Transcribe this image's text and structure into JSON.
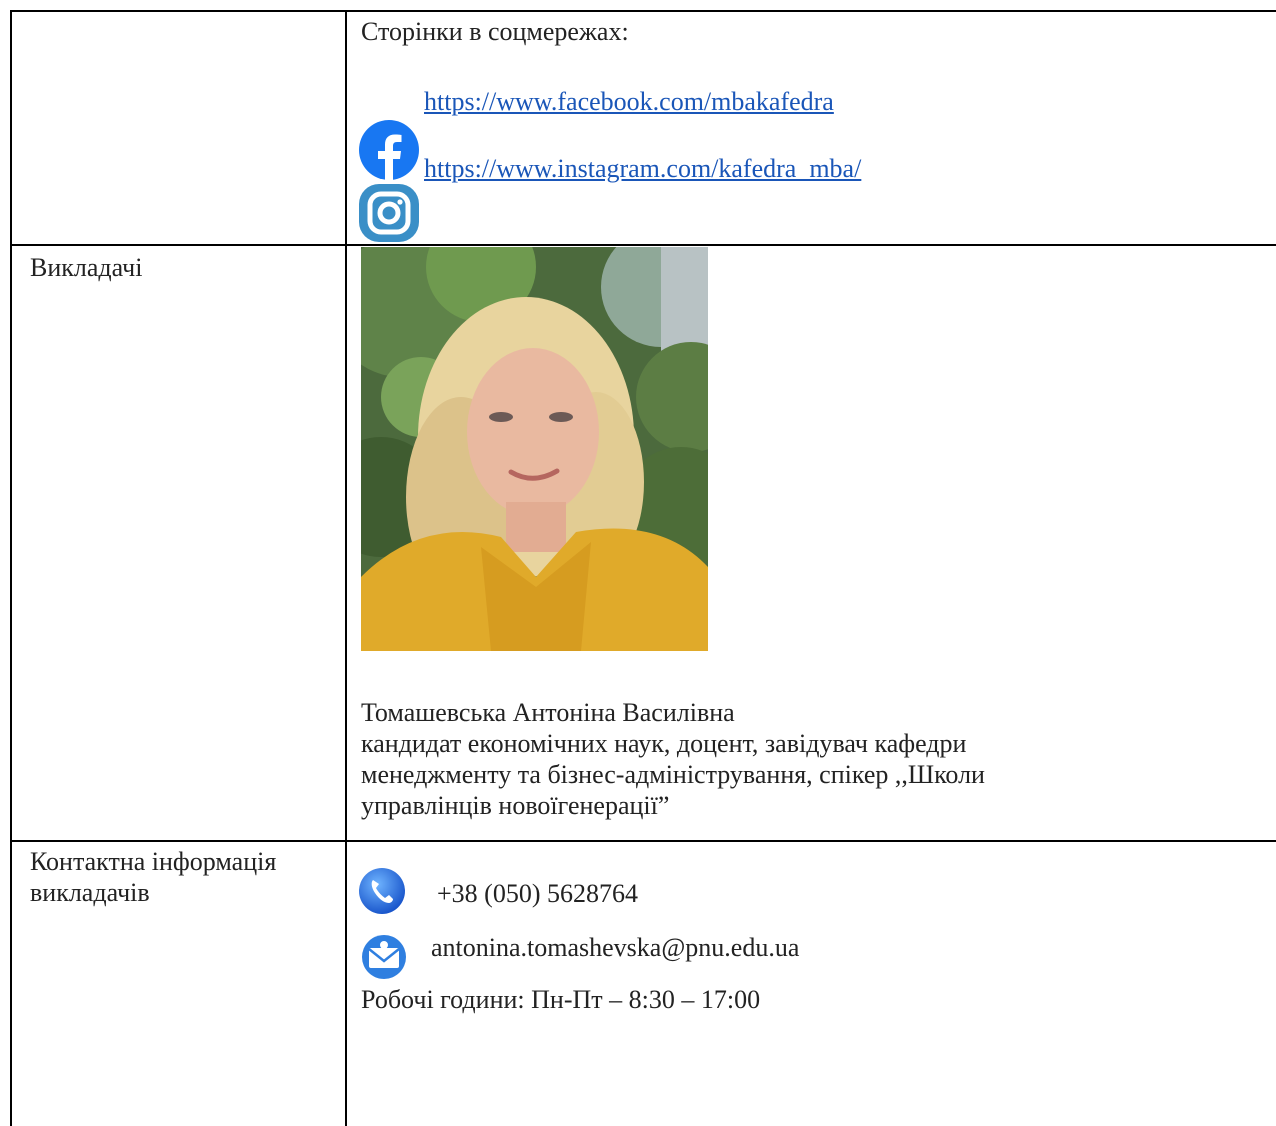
{
  "social": {
    "heading": "Сторінки в соцмережах:",
    "facebook_url": "https://www.facebook.com/mbakafedra",
    "instagram_url": "https://www.instagram.com/kafedra_mba/"
  },
  "teachers": {
    "label": "Викладачі",
    "name": "Томашевська Антоніна Василівна",
    "description_lines": [
      "кандидат економічних наук, доцент, завідувач кафедри",
      "менеджменту та бізнес-адміністрування, спікер ,,Школи",
      "управлінців новоїгенерації”"
    ]
  },
  "contacts": {
    "label_lines": [
      "Контактна інформація",
      "викладачів"
    ],
    "phone": "+38 (050)  5628764",
    "email": "antonina.tomashevska@pnu.edu.ua",
    "hours": "Робочі години: Пн-Пт – 8:30 – 17:00"
  },
  "icons": {
    "facebook": "facebook-icon",
    "instagram": "instagram-icon",
    "phone": "phone-icon",
    "email": "email-icon"
  },
  "colors": {
    "link": "#1a56b8",
    "facebook": "#1877f2",
    "instagram": "#3a8fc7",
    "phone": "#1f6fe0",
    "email": "#2f7fe0"
  }
}
